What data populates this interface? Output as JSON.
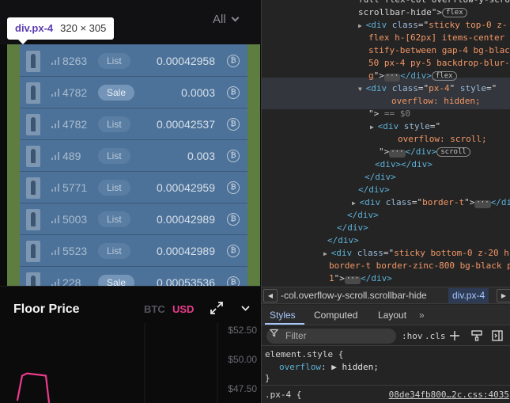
{
  "app": {
    "filter_label": "All",
    "tooltip": {
      "tag": "div.px-4",
      "dims": "320 × 305"
    },
    "rows": [
      {
        "count": "8263",
        "badge": "List",
        "price": "0.00042958"
      },
      {
        "count": "4782",
        "badge": "Sale",
        "price": "0.0003"
      },
      {
        "count": "4782",
        "badge": "List",
        "price": "0.00042537"
      },
      {
        "count": "489",
        "badge": "List",
        "price": "0.003"
      },
      {
        "count": "5771",
        "badge": "List",
        "price": "0.00042959"
      },
      {
        "count": "5003",
        "badge": "List",
        "price": "0.00042989"
      },
      {
        "count": "5523",
        "badge": "List",
        "price": "0.00042989"
      },
      {
        "count": "228",
        "badge": "Sale",
        "price": "0.00053536"
      }
    ],
    "coin_symbol": "₿",
    "floor": {
      "title": "Floor Price",
      "currency_btc": "BTC",
      "currency_usd": "USD"
    },
    "colors": {
      "accent": "#ec3b8c",
      "highlight_content": "#4d7299",
      "highlight_padding": "#5e7d40"
    }
  },
  "chart_data": {
    "type": "line",
    "title": "",
    "xlabel": "",
    "ylabel": "",
    "y_ticks": [
      "$52.50",
      "$50.00",
      "$47.50"
    ],
    "y_tick_values": [
      52.5,
      50.0,
      47.5
    ],
    "ylim": [
      46.2,
      53.1
    ],
    "series": [
      {
        "values": [
          46.5,
          48.6,
          48.8,
          48.7,
          48.6,
          46.3
        ]
      }
    ],
    "line_color": "#ec3b8c",
    "grid": true
  },
  "devtools": {
    "dom_lines": [
      {
        "tokens": [
          [
            "p",
            "full flex-col overflow-y-scroll "
          ]
        ],
        "indent": 122
      },
      {
        "tokens": [
          [
            "p",
            "scrollbar-hide\">"
          ],
          [
            "pill",
            "flex"
          ]
        ],
        "indent": 122
      },
      {
        "tokens": [
          [
            "tri",
            "▶ "
          ],
          [
            "t",
            "<div "
          ],
          [
            "a",
            "class"
          ],
          [
            "p",
            "=\""
          ],
          [
            "v",
            "sticky top-0 z-"
          ]
        ],
        "indent": 122
      },
      {
        "tokens": [
          [
            "v",
            "flex h-[62px] items-center j"
          ]
        ],
        "indent": 135
      },
      {
        "tokens": [
          [
            "v",
            "stify-between gap-4 bg-black"
          ]
        ],
        "indent": 135
      },
      {
        "tokens": [
          [
            "v",
            "50 px-4 py-5 backdrop-blur-"
          ]
        ],
        "indent": 135
      },
      {
        "tokens": [
          [
            "v",
            "g"
          ],
          [
            "p",
            "\">"
          ],
          [
            "ell",
            "···"
          ],
          [
            "t",
            "</div>"
          ],
          [
            "pill",
            "flex"
          ]
        ],
        "indent": 135
      },
      {
        "tokens": [
          [
            "tri",
            "▼ "
          ],
          [
            "t",
            "<div "
          ],
          [
            "a",
            "class"
          ],
          [
            "p",
            "=\""
          ],
          [
            "v",
            "px-4"
          ],
          [
            "p",
            "\" "
          ],
          [
            "a",
            "style"
          ],
          [
            "p",
            "=\""
          ]
        ],
        "indent": 122
      },
      {
        "tokens": [
          [
            "v",
            "overflow: hidden;"
          ]
        ],
        "indent": 164
      },
      {
        "tokens": [
          [
            "p",
            "\">"
          ],
          [
            "dim",
            " == $0"
          ]
        ],
        "indent": 135
      },
      {
        "tokens": [
          [
            "tri",
            "▶ "
          ],
          [
            "t",
            "<div "
          ],
          [
            "a",
            "style"
          ],
          [
            "p",
            "=\""
          ]
        ],
        "indent": 137
      },
      {
        "tokens": [
          [
            "v",
            "overflow: scroll;"
          ]
        ],
        "indent": 172
      },
      {
        "tokens": [
          [
            "p",
            "\">"
          ],
          [
            "ell",
            "···"
          ],
          [
            "t",
            "</div>"
          ],
          [
            "pill",
            "scroll"
          ]
        ],
        "indent": 148
      },
      {
        "tokens": [
          [
            "t",
            "<div></div>"
          ]
        ],
        "indent": 143
      },
      {
        "tokens": [
          [
            "t",
            "</div>"
          ]
        ],
        "indent": 130
      },
      {
        "tokens": [
          [
            "t",
            "</div>"
          ]
        ],
        "indent": 122
      },
      {
        "tokens": [
          [
            "tri",
            "▶ "
          ],
          [
            "t",
            "<div "
          ],
          [
            "a",
            "class"
          ],
          [
            "p",
            "=\""
          ],
          [
            "v",
            "border-t"
          ],
          [
            "p",
            "\">"
          ],
          [
            "ell",
            "···"
          ],
          [
            "t",
            "</di"
          ]
        ],
        "indent": 114
      },
      {
        "tokens": [
          [
            "t",
            "</div>"
          ]
        ],
        "indent": 108
      },
      {
        "tokens": [
          [
            "t",
            "</div>"
          ]
        ],
        "indent": 95
      },
      {
        "tokens": [
          [
            "t",
            "</div>"
          ]
        ],
        "indent": 83
      },
      {
        "tokens": [
          [
            "tri",
            "▶ "
          ],
          [
            "t",
            "<div "
          ],
          [
            "a",
            "class"
          ],
          [
            "p",
            "=\""
          ],
          [
            "v",
            "sticky bottom-0 z-20 h-"
          ]
        ],
        "indent": 78
      },
      {
        "tokens": [
          [
            "v",
            "border-t border-zinc-800 bg-black p"
          ]
        ],
        "indent": 85
      },
      {
        "tokens": [
          [
            "v",
            "1"
          ],
          [
            "p",
            "\">"
          ],
          [
            "ell",
            "···"
          ],
          [
            "t",
            "</div>"
          ]
        ],
        "indent": 85
      },
      {
        "tokens": [
          [
            "t",
            "</div>"
          ]
        ],
        "indent": 70
      }
    ],
    "breadcrumb": {
      "prev": "◀",
      "item": "-col.overflow-y-scroll.scrollbar-hide",
      "active": "div.px-4",
      "next": "▶"
    },
    "tabs": {
      "styles": "Styles",
      "computed": "Computed",
      "layout": "Layout",
      "more": "»"
    },
    "filter_placeholder": "Filter",
    "hov": ":hov",
    "cls": ".cls",
    "rules": {
      "element_style_selector": "element.style {",
      "element_style_prop": "overflow",
      "element_style_value": "hidden;",
      "close": "}",
      "second_selector": ".px-4 {",
      "second_source": "08de34fb800…2c.css:4035"
    }
  }
}
